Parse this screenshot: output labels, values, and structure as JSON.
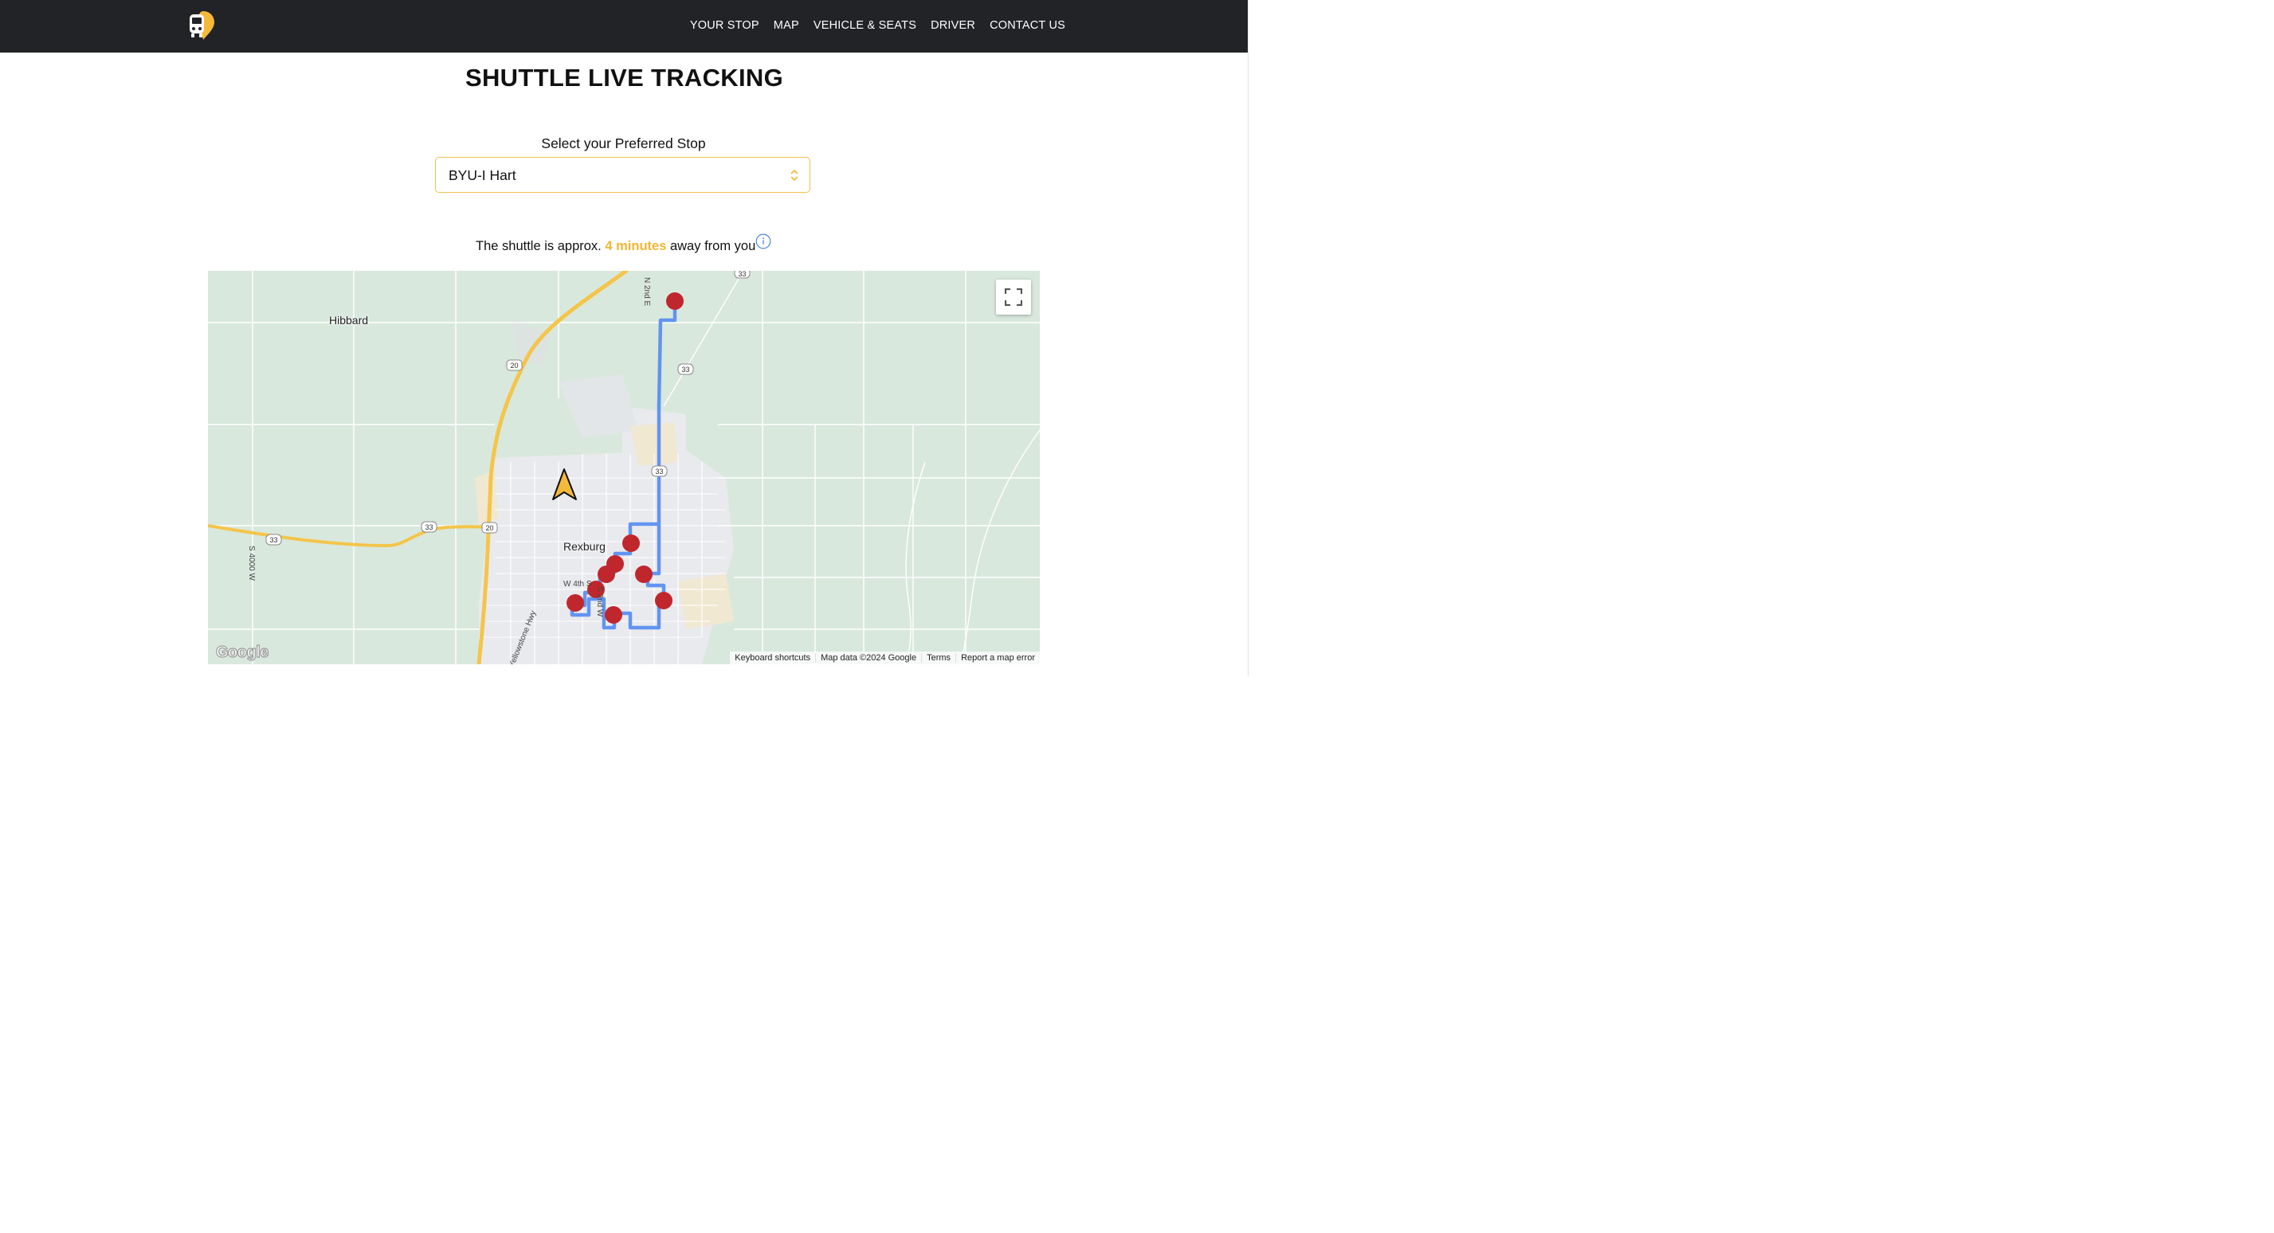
{
  "nav": {
    "links": [
      "YOUR STOP",
      "MAP",
      "VEHICLE & SEATS",
      "DRIVER",
      "CONTACT US"
    ]
  },
  "page": {
    "title": "SHUTTLE LIVE TRACKING",
    "stop_label": "Select your Preferred Stop",
    "selected_stop": "BYU-I Hart"
  },
  "eta": {
    "prefix": "The shuttle is approx.",
    "highlight": "4 minutes",
    "suffix": "away from you"
  },
  "map": {
    "places": {
      "hibbard": "Hibbard",
      "rexburg": "Rexburg"
    },
    "streets": {
      "n2nd_e": "N 2nd E",
      "s4000_w": "S 4000 W",
      "w4th": "W 4th S",
      "s2nd_w": "S 2nd W",
      "yellowstone": "Yellowstone Hwy"
    },
    "shields": [
      "33",
      "20",
      "33",
      "33",
      "33",
      "20",
      "33"
    ],
    "footer": {
      "keyboard": "Keyboard shortcuts",
      "data": "Map data ©2024 Google",
      "terms": "Terms",
      "report": "Report a map error"
    },
    "google_logo": "Google",
    "colors": {
      "route": "#5b8ff0",
      "stop_marker": "#c0272d",
      "shuttle_marker": "#f5b939",
      "land": "#d9e8dd",
      "urban": "#e9eaee",
      "highway": "#f4c54a"
    }
  },
  "icons": {
    "logo": "bus-pin-logo",
    "select": "chevron-updown-icon",
    "info": "info-icon",
    "fullscreen": "fullscreen-icon",
    "shuttle": "navigation-arrow-icon"
  },
  "colors": {
    "navbar": "#222326",
    "accent": "#f2b630"
  }
}
